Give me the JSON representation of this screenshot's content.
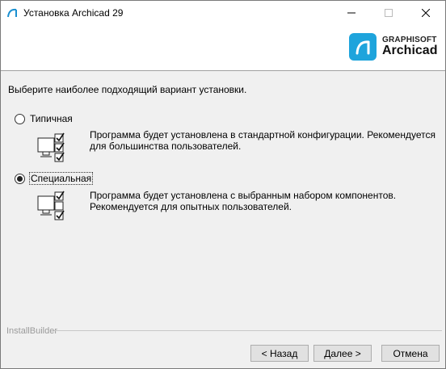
{
  "window": {
    "title": "Установка Archicad 29",
    "minimize_label": "—",
    "maximize_label": "☐",
    "close_label": "✕"
  },
  "header": {
    "brand": "GRAPHISOFT",
    "product": "Archicad"
  },
  "instruction": "Выберите наиболее подходящий вариант установки.",
  "options": [
    {
      "label": "Типичная",
      "selected": false,
      "description_line1": "Программа будет установлена в стандартной конфигурации. Рекомендуется",
      "description_line2": "для большинства пользователей."
    },
    {
      "label": "Специальная",
      "selected": true,
      "description_line1": "Программа будет установлена с выбранным набором компонентов.",
      "description_line2": "Рекомендуется для опытных пользователей."
    }
  ],
  "footer": {
    "brand": "InstallBuilder",
    "back_label": "< Назад",
    "next_label": "Далее >",
    "cancel_label": "Отмена"
  }
}
